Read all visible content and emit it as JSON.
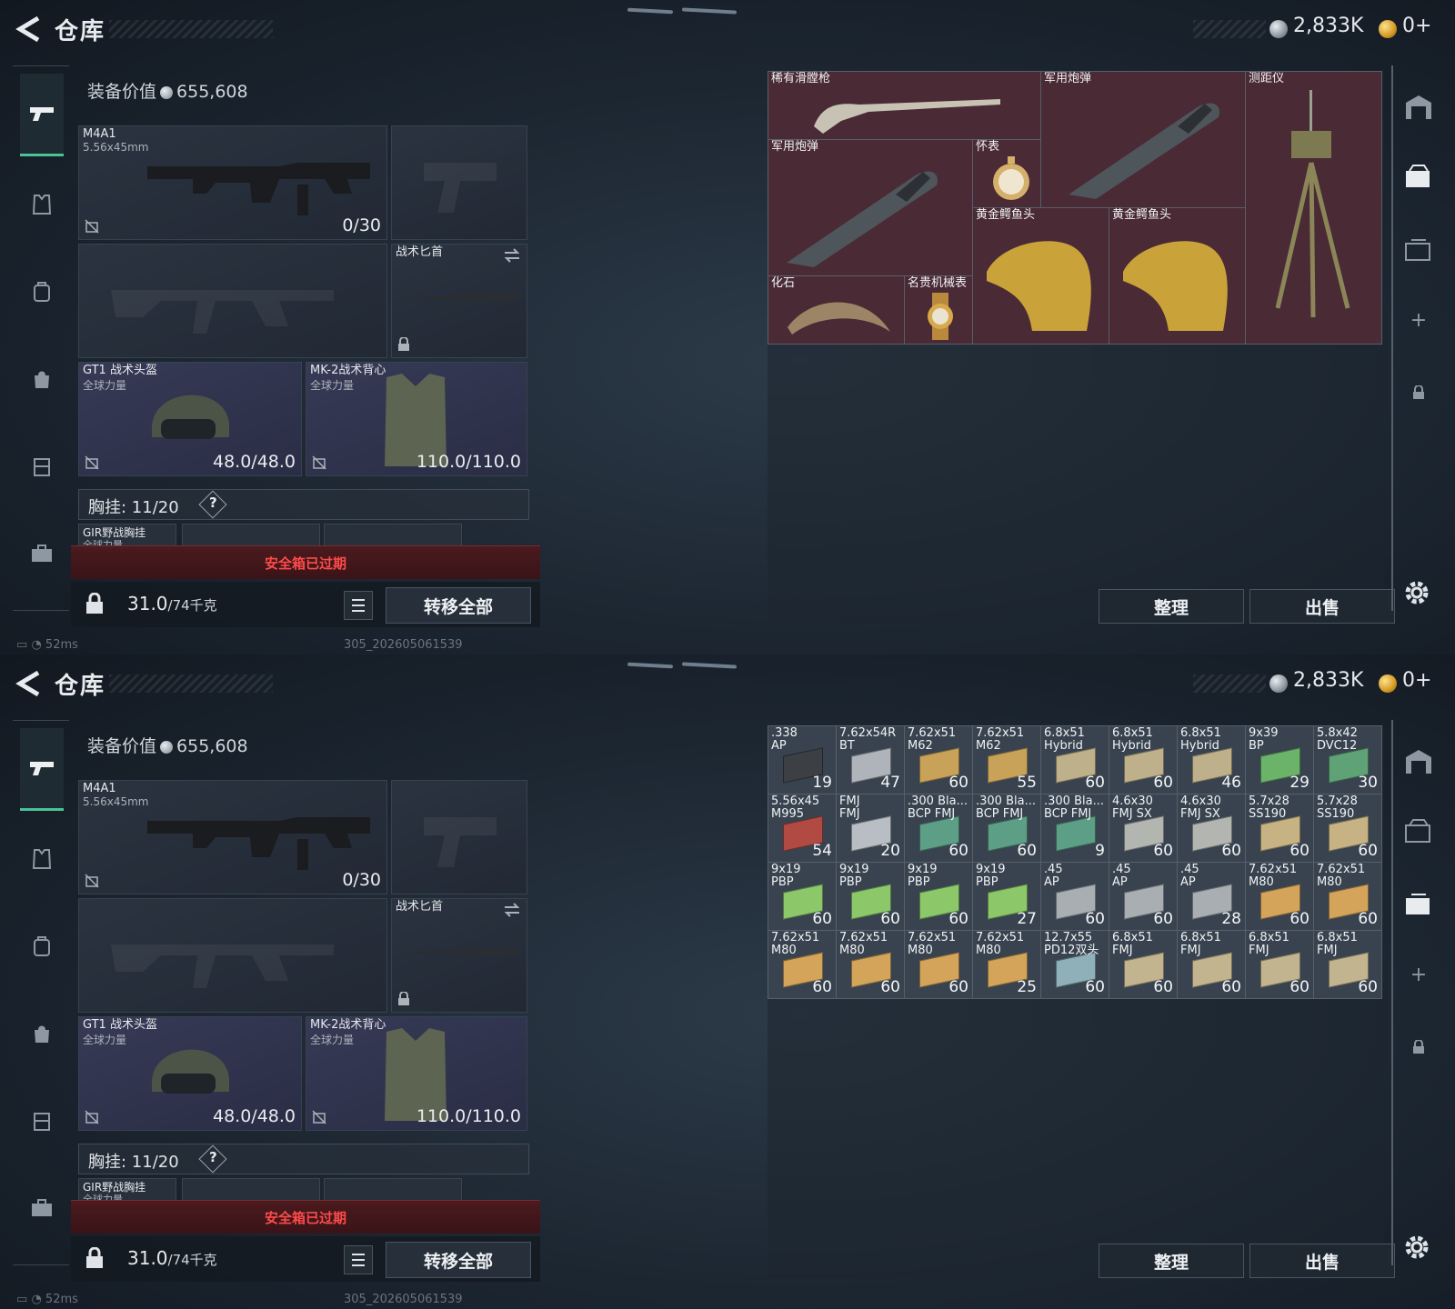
{
  "panels": [
    {
      "title": "仓库",
      "currency": {
        "silver": "2,833K",
        "gold": "0+"
      },
      "equip_label": "装备价值",
      "equip_value": "655,608",
      "slots": {
        "primary_name": "M4A1",
        "primary_caliber": "5.56x45mm",
        "primary_ammo": "0/30",
        "knife_name": "战术匕首",
        "helmet_name": "GT1 战术头盔",
        "helmet_sub": "全球力量",
        "helmet_dur": "48.0/48.0",
        "vest_name": "MK-2战术背心",
        "vest_sub": "全球力量",
        "vest_dur": "110.0/110.0"
      },
      "chest": {
        "label": "胸挂: 11/20",
        "help": "?",
        "first_item": "GIR野战胸挂",
        "first_item_sub": "全球力量"
      },
      "expired": "安全箱已过期",
      "weight": "31.0",
      "weight_max": "/74千克",
      "transfer_all": "转移全部",
      "sort": "整理",
      "sell": "出售",
      "status": {
        "ping": "52ms",
        "build": "305_202605061539"
      },
      "items": [
        {
          "name": "稀有滑膛枪"
        },
        {
          "name": "军用炮弹"
        },
        {
          "name": "测距仪"
        },
        {
          "name": "军用炮弹"
        },
        {
          "name": "怀表"
        },
        {
          "name": "黄金鳄鱼头"
        },
        {
          "name": "黄金鳄鱼头"
        },
        {
          "name": "化石"
        },
        {
          "name": "名贵机械表"
        }
      ]
    },
    {
      "title": "仓库",
      "currency": {
        "silver": "2,833K",
        "gold": "0+"
      },
      "equip_label": "装备价值",
      "equip_value": "655,608",
      "slots": {
        "primary_name": "M4A1",
        "primary_caliber": "5.56x45mm",
        "primary_ammo": "0/30",
        "knife_name": "战术匕首",
        "helmet_name": "GT1 战术头盔",
        "helmet_sub": "全球力量",
        "helmet_dur": "48.0/48.0",
        "vest_name": "MK-2战术背心",
        "vest_sub": "全球力量",
        "vest_dur": "110.0/110.0"
      },
      "chest": {
        "label": "胸挂: 11/20",
        "help": "?",
        "first_item": "GIR野战胸挂",
        "first_item_sub": "全球力量"
      },
      "expired": "安全箱已过期",
      "weight": "31.0",
      "weight_max": "/74千克",
      "transfer_all": "转移全部",
      "sort": "整理",
      "sell": "出售",
      "status": {
        "ping": "52ms",
        "build": "305_202605061539"
      },
      "ammo": [
        {
          "name": ".338\nAP",
          "count": "19",
          "color": "#3c3f44"
        },
        {
          "name": "7.62x54R\nBT",
          "count": "47",
          "color": "#aeb4ba"
        },
        {
          "name": "7.62x51\nM62",
          "count": "60",
          "color": "#c9a25a"
        },
        {
          "name": "7.62x51\nM62",
          "count": "55",
          "color": "#c9a25a"
        },
        {
          "name": "6.8x51\nHybrid",
          "count": "60",
          "color": "#bdb08a"
        },
        {
          "name": "6.8x51\nHybrid",
          "count": "60",
          "color": "#bdb08a"
        },
        {
          "name": "6.8x51\nHybrid",
          "count": "46",
          "color": "#bdb08a"
        },
        {
          "name": "9x39\nBP",
          "count": "29",
          "color": "#6cb36a"
        },
        {
          "name": "5.8x42\nDVC12",
          "count": "30",
          "color": "#5fa276"
        },
        {
          "name": "5.56x45\nM995",
          "count": "54",
          "color": "#b14a42"
        },
        {
          "name": "FMJ\nFMJ",
          "count": "20",
          "color": "#b8bec4"
        },
        {
          "name": ".300 Bla...\nBCP FMJ",
          "count": "60",
          "color": "#5c9e86"
        },
        {
          "name": ".300 Bla...\nBCP FMJ",
          "count": "60",
          "color": "#5c9e86"
        },
        {
          "name": ".300 Bla...\nBCP FMJ",
          "count": "9",
          "color": "#5c9e86"
        },
        {
          "name": "4.6x30\nFMJ SX",
          "count": "60",
          "color": "#b3b6b0"
        },
        {
          "name": "4.6x30\nFMJ SX",
          "count": "60",
          "color": "#b3b6b0"
        },
        {
          "name": "5.7x28\nSS190",
          "count": "60",
          "color": "#c7b283"
        },
        {
          "name": "5.7x28\nSS190",
          "count": "60",
          "color": "#c7b283"
        },
        {
          "name": "9x19\nPBP",
          "count": "60",
          "color": "#8cc86a"
        },
        {
          "name": "9x19\nPBP",
          "count": "60",
          "color": "#8cc86a"
        },
        {
          "name": "9x19\nPBP",
          "count": "60",
          "color": "#8cc86a"
        },
        {
          "name": "9x19\nPBP",
          "count": "27",
          "color": "#8cc86a"
        },
        {
          "name": ".45\nAP",
          "count": "60",
          "color": "#a9aeb2"
        },
        {
          "name": ".45\nAP",
          "count": "60",
          "color": "#a9aeb2"
        },
        {
          "name": ".45\nAP",
          "count": "28",
          "color": "#a9aeb2"
        },
        {
          "name": "7.62x51\nM80",
          "count": "60",
          "color": "#d3a45a"
        },
        {
          "name": "7.62x51\nM80",
          "count": "60",
          "color": "#d3a45a"
        },
        {
          "name": "7.62x51\nM80",
          "count": "60",
          "color": "#d3a45a"
        },
        {
          "name": "7.62x51\nM80",
          "count": "60",
          "color": "#d3a45a"
        },
        {
          "name": "7.62x51\nM80",
          "count": "60",
          "color": "#d3a45a"
        },
        {
          "name": "7.62x51\nM80",
          "count": "25",
          "color": "#d3a45a"
        },
        {
          "name": "12.7x55\nPD12双头",
          "count": "60",
          "color": "#8fb0b8"
        },
        {
          "name": "6.8x51\nFMJ",
          "count": "60",
          "color": "#c2b48e"
        },
        {
          "name": "6.8x51\nFMJ",
          "count": "60",
          "color": "#c2b48e"
        },
        {
          "name": "6.8x51\nFMJ",
          "count": "60",
          "color": "#c2b48e"
        },
        {
          "name": "6.8x51\nFMJ",
          "count": "60",
          "color": "#c2b48e"
        }
      ]
    }
  ]
}
